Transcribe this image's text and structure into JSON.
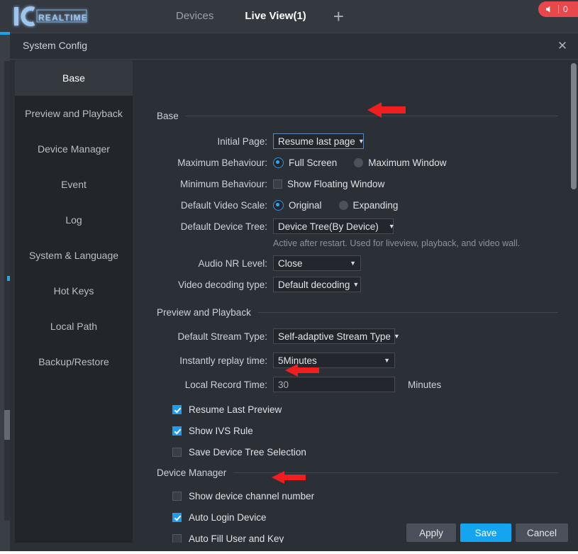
{
  "topbar": {
    "logo_text": "IC REALTIME",
    "logo_icon": "ic-realtime-logo",
    "tabs": [
      {
        "label": "Devices",
        "active": false
      },
      {
        "label": "Live View(1)",
        "active": true
      }
    ],
    "add_tab_icon": "plus-icon",
    "alert": {
      "icon": "speaker-icon",
      "count": "0"
    }
  },
  "dialog": {
    "title": "System Config",
    "close_icon": "close-icon"
  },
  "sidebar": {
    "items": [
      {
        "label": "Base",
        "active": true
      },
      {
        "label": "Preview and Playback",
        "active": false
      },
      {
        "label": "Device Manager",
        "active": false
      },
      {
        "label": "Event",
        "active": false
      },
      {
        "label": "Log",
        "active": false
      },
      {
        "label": "System & Language",
        "active": false
      },
      {
        "label": "Hot Keys",
        "active": false
      },
      {
        "label": "Local Path",
        "active": false
      },
      {
        "label": "Backup/Restore",
        "active": false
      }
    ]
  },
  "base": {
    "section_title": "Base",
    "initial_page": {
      "label": "Initial Page:",
      "value": "Resume last page",
      "caret_icon": "chevron-down-icon",
      "focused": true
    },
    "maximum_behaviour": {
      "label": "Maximum Behaviour:",
      "options": [
        {
          "label": "Full Screen",
          "selected": true
        },
        {
          "label": "Maximum Window",
          "selected": false
        }
      ]
    },
    "minimum_behaviour": {
      "label": "Minimum Behaviour:",
      "checkbox_label": "Show Floating Window",
      "checked": false
    },
    "default_video_scale": {
      "label": "Default Video Scale:",
      "options": [
        {
          "label": "Original",
          "selected": true
        },
        {
          "label": "Expanding",
          "selected": false
        }
      ]
    },
    "default_device_tree": {
      "label": "Default Device Tree:",
      "value": "Device Tree(By Device)",
      "caret_icon": "chevron-down-icon"
    },
    "device_tree_hint": "Active after restart. Used for liveview, playback, and video wall.",
    "audio_nr_level": {
      "label": "Audio NR Level:",
      "value": "Close",
      "caret_icon": "chevron-down-icon"
    },
    "video_decoding_type": {
      "label": "Video decoding type:",
      "value": "Default decoding",
      "caret_icon": "chevron-down-icon"
    }
  },
  "preview": {
    "section_title": "Preview and Playback",
    "default_stream_type": {
      "label": "Default Stream Type:",
      "value": "Self-adaptive Stream Type",
      "caret_icon": "chevron-down-icon"
    },
    "instantly_replay_time": {
      "label": "Instantly replay time:",
      "value": "5Minutes",
      "caret_icon": "chevron-down-icon"
    },
    "local_record_time": {
      "label": "Local Record Time:",
      "value": "30",
      "placeholder": "30",
      "unit": "Minutes"
    },
    "checkboxes": [
      {
        "label": "Resume Last Preview",
        "checked": true
      },
      {
        "label": "Show IVS Rule",
        "checked": true
      },
      {
        "label": "Save Device Tree Selection",
        "checked": false
      }
    ]
  },
  "device_manager": {
    "section_title": "Device Manager",
    "checkboxes": [
      {
        "label": "Show device channel number",
        "checked": false
      },
      {
        "label": "Auto Login Device",
        "checked": true
      },
      {
        "label": "Auto Fill User and Key",
        "checked": false
      }
    ]
  },
  "footer": {
    "apply_label": "Apply",
    "save_label": "Save",
    "cancel_label": "Cancel"
  },
  "colors": {
    "accent_blue": "#15a5f0",
    "checkbox_blue": "#1f9bf0",
    "alert_red": "#e8474c",
    "callout_red": "#f01e1e",
    "panel_bg": "#2b2f36",
    "sidebar_bg": "#22262b"
  }
}
